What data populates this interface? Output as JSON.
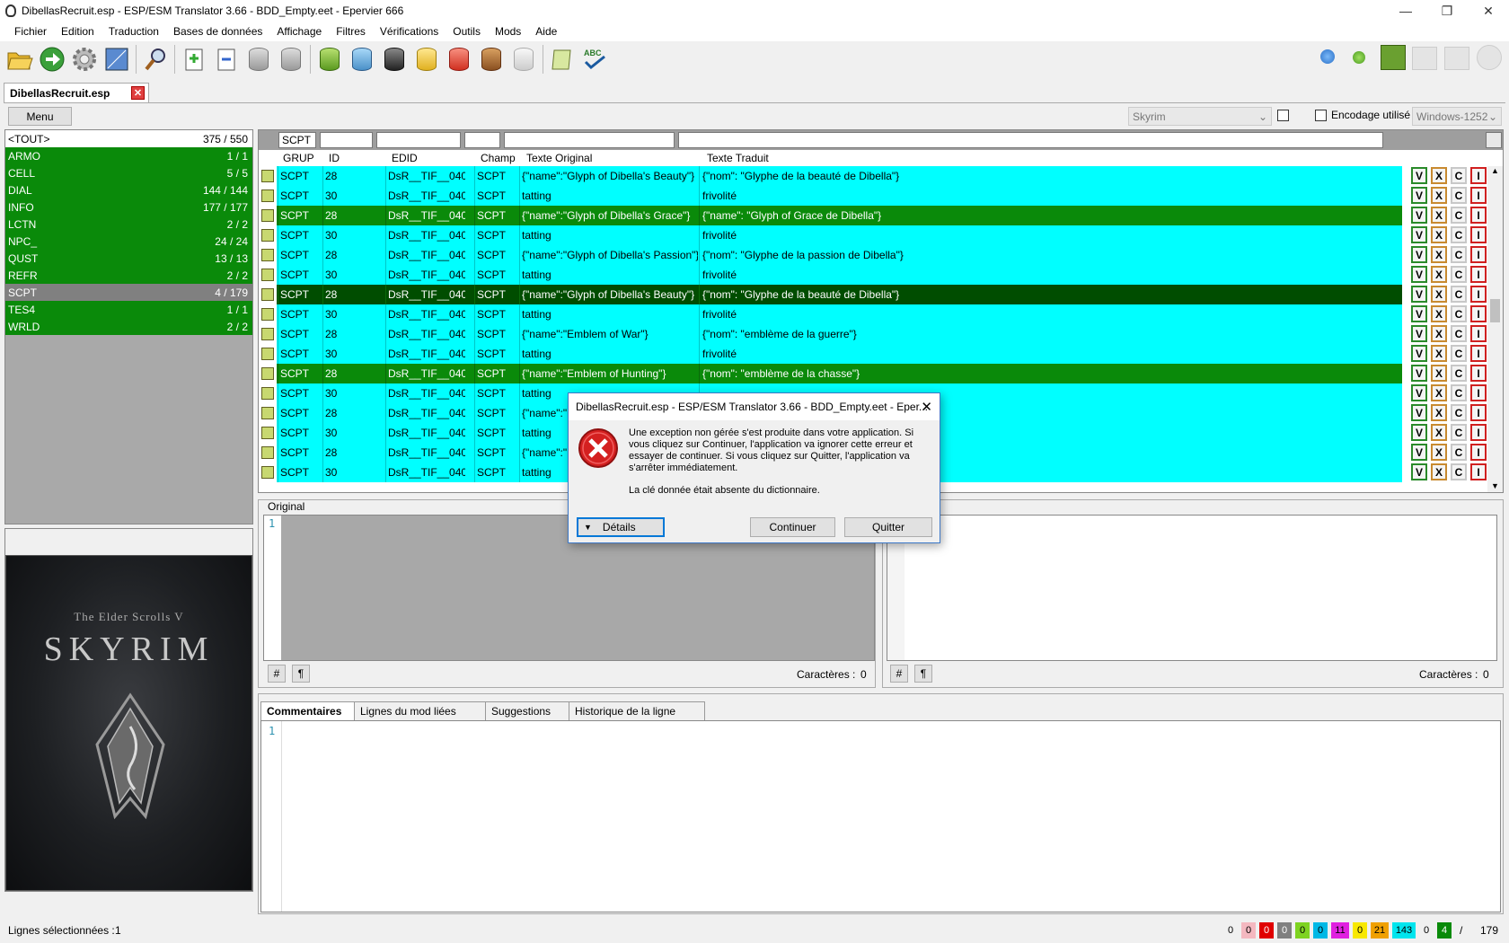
{
  "window": {
    "title": "DibellasRecruit.esp - ESP/ESM Translator 3.66 - BDD_Empty.eet - Epervier 666",
    "min": "—",
    "max": "❐",
    "close": "✕"
  },
  "menu": [
    "Fichier",
    "Edition",
    "Traduction",
    "Bases de données",
    "Affichage",
    "Filtres",
    "Vérifications",
    "Outils",
    "Mods",
    "Aide"
  ],
  "toolbar_icons": [
    "open-folder-icon",
    "go-arrow-icon",
    "gear-icon",
    "blueprint-icon",
    "search-magnifier-icon",
    "import-doc-icon",
    "export-doc-icon",
    "db-up-icon",
    "db-add-icon",
    "db-green-icon",
    "db-blue-icon",
    "db-black-icon",
    "db-yellow-icon",
    "db-red-icon",
    "db-brown-icon",
    "db-white-icon",
    "scroll-icon",
    "spellcheck-icon"
  ],
  "toolbar_abc": "ABC",
  "doc_tab": {
    "label": "DibellasRecruit.esp",
    "close": "✕"
  },
  "menu_button": "Menu",
  "game_select": "Skyrim",
  "encoding_label": "Encodage utilisé",
  "encoding_select": "Windows-1252",
  "left_list": [
    {
      "name": "<TOUT>",
      "count": "375 / 550",
      "kind": "all"
    },
    {
      "name": "ARMO",
      "count": "1 / 1"
    },
    {
      "name": "CELL",
      "count": "5 / 5"
    },
    {
      "name": "DIAL",
      "count": "144 / 144"
    },
    {
      "name": "INFO",
      "count": "177 / 177"
    },
    {
      "name": "LCTN",
      "count": "2 / 2"
    },
    {
      "name": "NPC_",
      "count": "24 / 24"
    },
    {
      "name": "QUST",
      "count": "13 / 13"
    },
    {
      "name": "REFR",
      "count": "2 / 2"
    },
    {
      "name": "SCPT",
      "count": "4 / 179",
      "kind": "sel"
    },
    {
      "name": "TES4",
      "count": "1 / 1"
    },
    {
      "name": "WRLD",
      "count": "2 / 2"
    }
  ],
  "skyrim": {
    "line1": "The Elder Scrolls V",
    "line2": "SKYRIM"
  },
  "filter_grup": "SCPT",
  "columns": [
    "GRUP",
    "ID",
    "EDID",
    "Champ",
    "Texte Original",
    "Texte Traduit"
  ],
  "rows": [
    {
      "grup": "SCPT",
      "id": "28",
      "edid": "DsR__TIF__040...",
      "champ": "SCPT",
      "orig": "{\"name\":\"Glyph of Dibella's Beauty\"}",
      "trad": "{\"nom\": \"Glyphe de la beauté de Dibella\"}",
      "style": "cyan"
    },
    {
      "grup": "SCPT",
      "id": "30",
      "edid": "DsR__TIF__040...",
      "champ": "SCPT",
      "orig": "tatting",
      "trad": "frivolité",
      "style": "cyan"
    },
    {
      "grup": "SCPT",
      "id": "28",
      "edid": "DsR__TIF__040...",
      "champ": "SCPT",
      "orig": "{\"name\":\"Glyph of Dibella's Grace\"}",
      "trad": "{\"name\": \"Glyph of Grace de Dibella\"}",
      "style": "green"
    },
    {
      "grup": "SCPT",
      "id": "30",
      "edid": "DsR__TIF__040...",
      "champ": "SCPT",
      "orig": "tatting",
      "trad": "frivolité",
      "style": "cyan"
    },
    {
      "grup": "SCPT",
      "id": "28",
      "edid": "DsR__TIF__040...",
      "champ": "SCPT",
      "orig": "{\"name\":\"Glyph of Dibella's Passion\"}",
      "trad": "{\"nom\": \"Glyphe de la passion de Dibella\"}",
      "style": "cyan"
    },
    {
      "grup": "SCPT",
      "id": "30",
      "edid": "DsR__TIF__040...",
      "champ": "SCPT",
      "orig": "tatting",
      "trad": "frivolité",
      "style": "cyan"
    },
    {
      "grup": "SCPT",
      "id": "28",
      "edid": "DsR__TIF__040...",
      "champ": "SCPT",
      "orig": "{\"name\":\"Glyph of Dibella's Beauty\"}",
      "trad": "{\"nom\": \"Glyphe de la beauté de Dibella\"}",
      "style": "greensel"
    },
    {
      "grup": "SCPT",
      "id": "30",
      "edid": "DsR__TIF__040...",
      "champ": "SCPT",
      "orig": "tatting",
      "trad": "frivolité",
      "style": "cyan"
    },
    {
      "grup": "SCPT",
      "id": "28",
      "edid": "DsR__TIF__040...",
      "champ": "SCPT",
      "orig": "{\"name\":\"Emblem of War\"}",
      "trad": "{\"nom\": \"emblème de la guerre\"}",
      "style": "cyan"
    },
    {
      "grup": "SCPT",
      "id": "30",
      "edid": "DsR__TIF__040...",
      "champ": "SCPT",
      "orig": "tatting",
      "trad": "frivolité",
      "style": "cyan"
    },
    {
      "grup": "SCPT",
      "id": "28",
      "edid": "DsR__TIF__040...",
      "champ": "SCPT",
      "orig": "{\"name\":\"Emblem of Hunting\"}",
      "trad": "{\"nom\": \"emblème de la chasse\"}",
      "style": "green"
    },
    {
      "grup": "SCPT",
      "id": "30",
      "edid": "DsR__TIF__040...",
      "champ": "SCPT",
      "orig": "tatting",
      "trad": "",
      "style": "cyan"
    },
    {
      "grup": "SCPT",
      "id": "28",
      "edid": "DsR__TIF__040...",
      "champ": "SCPT",
      "orig": "{\"name\":\"E",
      "trad": "",
      "style": "cyan"
    },
    {
      "grup": "SCPT",
      "id": "30",
      "edid": "DsR__TIF__040...",
      "champ": "SCPT",
      "orig": "tatting",
      "trad": "",
      "style": "cyan"
    },
    {
      "grup": "SCPT",
      "id": "28",
      "edid": "DsR__TIF__040...",
      "champ": "SCPT",
      "orig": "{\"name\":\"E",
      "trad": "",
      "style": "cyan"
    },
    {
      "grup": "SCPT",
      "id": "30",
      "edid": "DsR__TIF__040...",
      "champ": "SCPT",
      "orig": "tatting",
      "trad": "",
      "style": "cyan"
    }
  ],
  "row_actions": [
    "V",
    "X",
    "C",
    "I"
  ],
  "original_panel": {
    "label": "Original",
    "line1": "1",
    "hash": "#",
    "pilcrow": "¶",
    "chars_label": "Caractères :",
    "chars": "0"
  },
  "translated_panel": {
    "hash": "#",
    "pilcrow": "¶",
    "chars_label": "Caractères :",
    "chars": "0"
  },
  "bottom_tabs": [
    "Commentaires",
    "Lignes du mod liées",
    "Suggestions",
    "Historique de la ligne"
  ],
  "comments_line1": "1",
  "status": {
    "label": "Lignes sélectionnées :",
    "value": "1",
    "sep": "/",
    "total": "179"
  },
  "counters": [
    {
      "v": "0",
      "bg": "#f0f0f0",
      "fg": "#000"
    },
    {
      "v": "0",
      "bg": "#f4b8c0",
      "fg": "#000"
    },
    {
      "v": "0",
      "bg": "#e00000",
      "fg": "#fff"
    },
    {
      "v": "0",
      "bg": "#808080",
      "fg": "#fff"
    },
    {
      "v": "0",
      "bg": "#7ed321",
      "fg": "#000"
    },
    {
      "v": "0",
      "bg": "#00b8e6",
      "fg": "#000"
    },
    {
      "v": "11",
      "bg": "#e020e0",
      "fg": "#000"
    },
    {
      "v": "0",
      "bg": "#f8e800",
      "fg": "#000"
    },
    {
      "v": "21",
      "bg": "#f0a000",
      "fg": "#000"
    },
    {
      "v": "143",
      "bg": "#00e5ee",
      "fg": "#000"
    },
    {
      "v": "0",
      "bg": "#f0f0f0",
      "fg": "#000"
    },
    {
      "v": "4",
      "bg": "#0a8a0a",
      "fg": "#fff"
    }
  ],
  "dialog": {
    "title": "DibellasRecruit.esp - ESP/ESM Translator 3.66 - BDD_Empty.eet - Eper...",
    "close": "✕",
    "message_lines": [
      "Une exception non gérée s'est produite dans votre application. Si",
      "vous cliquez sur Continuer, l'application va ignorer cette erreur et",
      "essayer de continuer. Si vous cliquez sur Quitter, l'application va",
      "s'arrêter immédiatement."
    ],
    "detail": "La clé donnée était absente du dictionnaire.",
    "details_btn": "Détails",
    "continue_btn": "Continuer",
    "quit_btn": "Quitter"
  },
  "colors": {
    "cyan": "#00ffff",
    "green": "#0a8a0a",
    "greensel": "#004d00"
  }
}
